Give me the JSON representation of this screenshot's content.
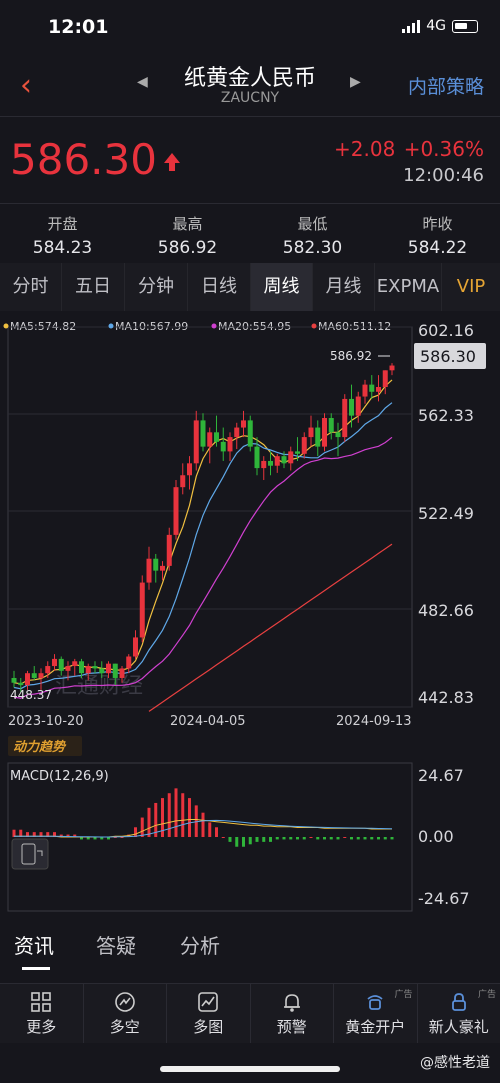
{
  "status": {
    "time": "12:01",
    "network": "4G"
  },
  "header": {
    "back_icon": "chevron-left-icon",
    "title": "纸黄金人民币",
    "subtitle": "ZAUCNY",
    "right_link": "内部策略"
  },
  "quote": {
    "price": "586.30",
    "change": "+2.08",
    "change_pct": "+0.36%",
    "time": "12:00:46",
    "up_color": "#e8333d"
  },
  "ohlc": [
    {
      "label": "开盘",
      "value": "584.23"
    },
    {
      "label": "最高",
      "value": "586.92"
    },
    {
      "label": "最低",
      "value": "582.30"
    },
    {
      "label": "昨收",
      "value": "584.22"
    }
  ],
  "tabs": [
    "分时",
    "五日",
    "分钟",
    "日线",
    "周线",
    "月线",
    "EXPMA",
    "VIP"
  ],
  "active_tab": "周线",
  "chart_data": {
    "type": "candlestick",
    "ma_legend": [
      {
        "label": "MA5:574.82",
        "color": "#f0c040"
      },
      {
        "label": "MA10:567.99",
        "color": "#5fa8e8"
      },
      {
        "label": "MA20:554.95",
        "color": "#d040d0"
      },
      {
        "label": "MA60:511.12",
        "color": "#e84040"
      }
    ],
    "y_ticks": [
      "602.16",
      "562.33",
      "522.49",
      "482.66",
      "442.83"
    ],
    "ylim": [
      442.83,
      602.16
    ],
    "current_price_label": "586.30",
    "high_label": "586.92",
    "low_label": "448.37",
    "x_labels": [
      "2023-10-20",
      "2024-04-05",
      "2024-09-13"
    ],
    "watermark": "汇通财经",
    "indicator_badge": "动力趋势",
    "macd": {
      "title": "MACD(12,26,9)",
      "y_ticks": [
        "24.67",
        "0.00",
        "-24.67"
      ],
      "ylim": [
        -24.67,
        24.67
      ]
    },
    "candles": [
      [
        455,
        458,
        451,
        453
      ],
      [
        453,
        455,
        449,
        452
      ],
      [
        452,
        458,
        450,
        457
      ],
      [
        457,
        460,
        454,
        455
      ],
      [
        455,
        459,
        450,
        457
      ],
      [
        457,
        462,
        455,
        460
      ],
      [
        460,
        465,
        458,
        463
      ],
      [
        463,
        464,
        456,
        458
      ],
      [
        458,
        462,
        454,
        460
      ],
      [
        460,
        463,
        456,
        462
      ],
      [
        462,
        463,
        455,
        457
      ],
      [
        457,
        461,
        454,
        460
      ],
      [
        460,
        462,
        457,
        459
      ],
      [
        459,
        462,
        455,
        457
      ],
      [
        457,
        462,
        455,
        461
      ],
      [
        461,
        461,
        452,
        455
      ],
      [
        455,
        460,
        453,
        459
      ],
      [
        459,
        465,
        457,
        464
      ],
      [
        464,
        475,
        463,
        472
      ],
      [
        472,
        498,
        470,
        495
      ],
      [
        495,
        510,
        492,
        505
      ],
      [
        505,
        507,
        495,
        500
      ],
      [
        500,
        504,
        496,
        502
      ],
      [
        502,
        518,
        500,
        515
      ],
      [
        515,
        538,
        513,
        535
      ],
      [
        535,
        545,
        532,
        540
      ],
      [
        540,
        548,
        534,
        545
      ],
      [
        545,
        567,
        542,
        563
      ],
      [
        563,
        566,
        550,
        552
      ],
      [
        552,
        560,
        545,
        558
      ],
      [
        558,
        565,
        552,
        554
      ],
      [
        554,
        560,
        546,
        550
      ],
      [
        550,
        558,
        546,
        556
      ],
      [
        556,
        562,
        551,
        560
      ],
      [
        560,
        567,
        556,
        563
      ],
      [
        563,
        565,
        550,
        552
      ],
      [
        552,
        556,
        540,
        543
      ],
      [
        543,
        548,
        538,
        546
      ],
      [
        546,
        550,
        540,
        544
      ],
      [
        544,
        549,
        541,
        548
      ],
      [
        548,
        550,
        543,
        545
      ],
      [
        545,
        552,
        542,
        550
      ],
      [
        550,
        556,
        546,
        549
      ],
      [
        549,
        558,
        547,
        556
      ],
      [
        556,
        565,
        552,
        560
      ],
      [
        560,
        563,
        548,
        552
      ],
      [
        552,
        566,
        550,
        564
      ],
      [
        564,
        566,
        555,
        558
      ],
      [
        558,
        562,
        548,
        556
      ],
      [
        556,
        574,
        554,
        572
      ],
      [
        572,
        578,
        560,
        565
      ],
      [
        565,
        575,
        562,
        573
      ],
      [
        573,
        580,
        570,
        578
      ],
      [
        578,
        582,
        572,
        575
      ],
      [
        575,
        582,
        571,
        577
      ],
      [
        577,
        584,
        574,
        584
      ],
      [
        584,
        587,
        582,
        586
      ]
    ]
  },
  "bottom_tabs": [
    "资讯",
    "答疑",
    "分析"
  ],
  "toolbar": [
    {
      "label": "更多",
      "icon": "grid-icon",
      "ad": ""
    },
    {
      "label": "多空",
      "icon": "gauge-icon",
      "ad": ""
    },
    {
      "label": "多图",
      "icon": "chart-icon",
      "ad": ""
    },
    {
      "label": "预警",
      "icon": "bell-icon",
      "ad": ""
    },
    {
      "label": "黄金开户",
      "icon": "gold-icon",
      "ad": "广告"
    },
    {
      "label": "新人豪礼",
      "icon": "lock-icon",
      "ad": "广告"
    }
  ],
  "footer_watermark": "@感性老道"
}
